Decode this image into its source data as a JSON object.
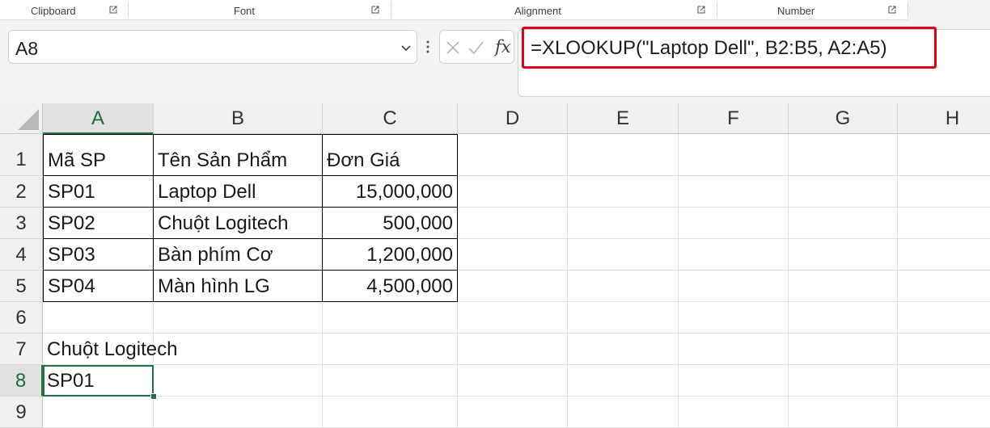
{
  "ribbon": {
    "groups": [
      {
        "label": "Clipboard"
      },
      {
        "label": "Font"
      },
      {
        "label": "Alignment"
      },
      {
        "label": "Number"
      }
    ],
    "launcher_icon": "dialog-launcher-icon"
  },
  "formula_bar": {
    "name_box": "A8",
    "formula": "=XLOOKUP(\"Laptop Dell\", B2:B5, A2:A5)",
    "fx_label": "fx",
    "highlight_color": "#e0001b"
  },
  "sheet": {
    "columns": [
      "A",
      "B",
      "C",
      "D",
      "E",
      "F",
      "G",
      "H"
    ],
    "active_column": "A",
    "active_row": "8",
    "rows": [
      {
        "num": "1",
        "cells": [
          "Mã SP",
          "Tên Sản Phẩm",
          "Đơn Giá"
        ]
      },
      {
        "num": "2",
        "cells": [
          "SP01",
          "Laptop Dell",
          "15,000,000"
        ]
      },
      {
        "num": "3",
        "cells": [
          "SP02",
          "Chuột Logitech",
          "500,000"
        ]
      },
      {
        "num": "4",
        "cells": [
          "SP03",
          "Bàn phím Cơ",
          "1,200,000"
        ]
      },
      {
        "num": "5",
        "cells": [
          "SP04",
          "Màn hình LG",
          "4,500,000"
        ]
      },
      {
        "num": "6",
        "cells": [
          "",
          "",
          ""
        ]
      },
      {
        "num": "7",
        "cells": [
          "Chuột Logitech",
          "",
          ""
        ]
      },
      {
        "num": "8",
        "cells": [
          "SP01",
          "",
          ""
        ]
      },
      {
        "num": "9",
        "cells": [
          "",
          "",
          ""
        ]
      }
    ],
    "accent_color": "#217346"
  }
}
